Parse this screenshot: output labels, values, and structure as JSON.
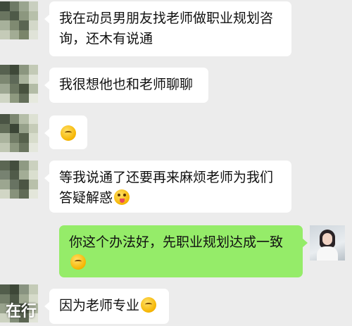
{
  "colors": {
    "background": "#ececec",
    "incoming_bubble": "#ffffff",
    "outgoing_bubble": "#95ec69"
  },
  "messages": [
    {
      "side": "left",
      "text": "我在动员男朋友找老师做职业规划咨询，还木有说通",
      "emoji": null
    },
    {
      "side": "left",
      "text": "我很想他也和老师聊聊",
      "emoji": null
    },
    {
      "side": "left",
      "text": "",
      "emoji": "thinking-emoji"
    },
    {
      "side": "left",
      "text": "等我说通了还要再来麻烦老师为我们答疑解惑",
      "emoji": "tongue-wink-emoji"
    },
    {
      "side": "right",
      "text": "你这个办法好，先职业规划达成一致",
      "emoji": "thinking-emoji"
    },
    {
      "side": "left",
      "text": "因为老师专业",
      "emoji": "thinking-emoji"
    }
  ],
  "watermark": "在行"
}
